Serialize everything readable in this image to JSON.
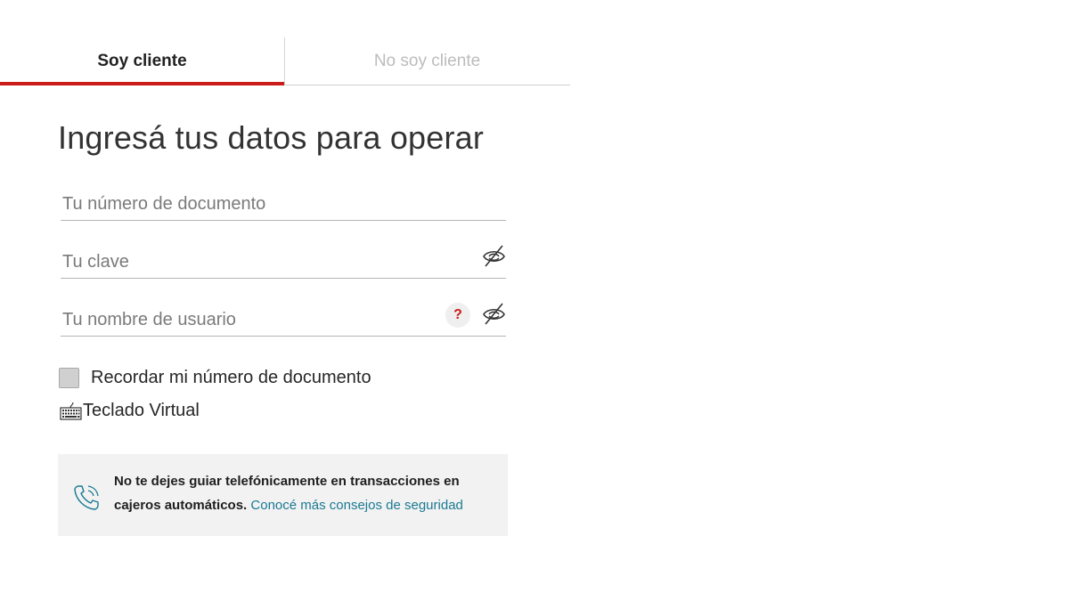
{
  "tabs": [
    {
      "label": "Soy cliente",
      "active": true
    },
    {
      "label": "No soy cliente",
      "active": false
    }
  ],
  "form": {
    "title": "Ingresá tus datos para operar",
    "document_field": {
      "placeholder": "Tu número de documento",
      "value": ""
    },
    "password_field": {
      "placeholder": "Tu clave",
      "value": "",
      "icon": "eye-slash-icon"
    },
    "username_field": {
      "placeholder": "Tu nombre de usuario",
      "value": "",
      "help_label": "?",
      "icon": "eye-slash-icon"
    },
    "remember": {
      "label": "Recordar mi número de documento",
      "checked": false
    },
    "virtual_keyboard": {
      "label": "Teclado Virtual",
      "icon": "keyboard-icon"
    }
  },
  "notice": {
    "icon": "phone-icon",
    "text": "No te dejes guiar telefónicamente en transacciones en cajeros automáticos.",
    "link": "Conocé más consejos de seguridad"
  },
  "colors": {
    "accent": "#cc1b1b",
    "link": "#1a7a93",
    "notice_bg": "#f2f2f2"
  }
}
